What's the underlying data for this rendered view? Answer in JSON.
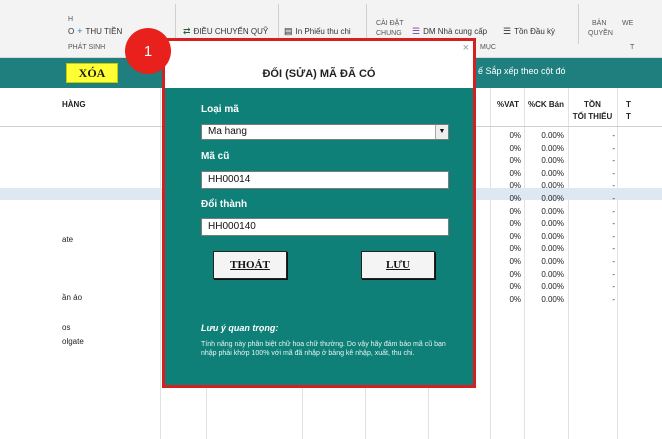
{
  "ribbon": {
    "left_top_fragment": "H",
    "left_bottom_fragment": "O",
    "thu_tien": "THU TIỀN",
    "phat_sinh": "PHÁT SINH",
    "dieu_chuyen_quy": "ĐIỀU CHUYỂN QUỸ",
    "in_phieu_thu_chi": "In Phiếu thu chi",
    "cai_dat": "CÀI ĐẶT",
    "chung": "CHUNG",
    "dm_nha_cung_cap": "DM Nhà cung cấp",
    "muc": "MỤC",
    "ton_dau_ky": "Tồn Đầu kỳ",
    "ban": "BẢN",
    "quyen": "QUYỀN",
    "we": "WE",
    "right_fragment": "T"
  },
  "action_bar": {
    "delete_label": "XÓA",
    "sort_hint": "ế Sắp xếp theo cột đó"
  },
  "table": {
    "header_hang": "HÀNG",
    "header_vat": "%VAT",
    "header_ck": "%CK Bán",
    "header_ton_line1": "TỒN",
    "header_ton_line2": "TỐI THIỂU",
    "header_t1": "T",
    "header_t2": "T",
    "name_fragments": [
      "ate",
      "ần áo",
      "os",
      "olgate"
    ],
    "vat_values": [
      "0%",
      "0%",
      "0%",
      "0%",
      "0%",
      "0%",
      "0%",
      "0%",
      "0%",
      "0%",
      "0%",
      "0%",
      "0%",
      "0%"
    ],
    "ck_values": [
      "0.00%",
      "0.00%",
      "0.00%",
      "0.00%",
      "0.00%",
      "0.00%",
      "0.00%",
      "0.00%",
      "0.00%",
      "0.00%",
      "0.00%",
      "0.00%",
      "0.00%",
      "0.00%"
    ],
    "ton_values": [
      "-",
      "-",
      "-",
      "-",
      "-",
      "-",
      "-",
      "-",
      "-",
      "-",
      "-",
      "-",
      "-",
      "-"
    ]
  },
  "badge": "1",
  "dialog": {
    "close": "×",
    "title": "ĐỔI (SỬA) MÃ ĐÃ CÓ",
    "loai_ma_label": "Loại mã",
    "loai_ma_value": "Ma hang",
    "ma_cu_label": "Mã cũ",
    "ma_cu_value": "HH00014",
    "doi_thanh_label": "Đổi thành",
    "doi_thanh_value": "HH000140",
    "thoat_label": "THOÁT",
    "luu_label": "LƯU",
    "note_title": "Lưu ý quan trọng:",
    "note_text": "Tính năng này phân biệt chữ hoa chữ thường. Do vậy hãy đảm bảo mã cũ bạn nhập phải khớp 100% với mã đã nhập ở bảng kê nhập, xuất, thu chi."
  },
  "colors": {
    "teal": "#0e8078",
    "highlight_red": "#e8211c",
    "xoa_yellow": "#ffff33"
  }
}
